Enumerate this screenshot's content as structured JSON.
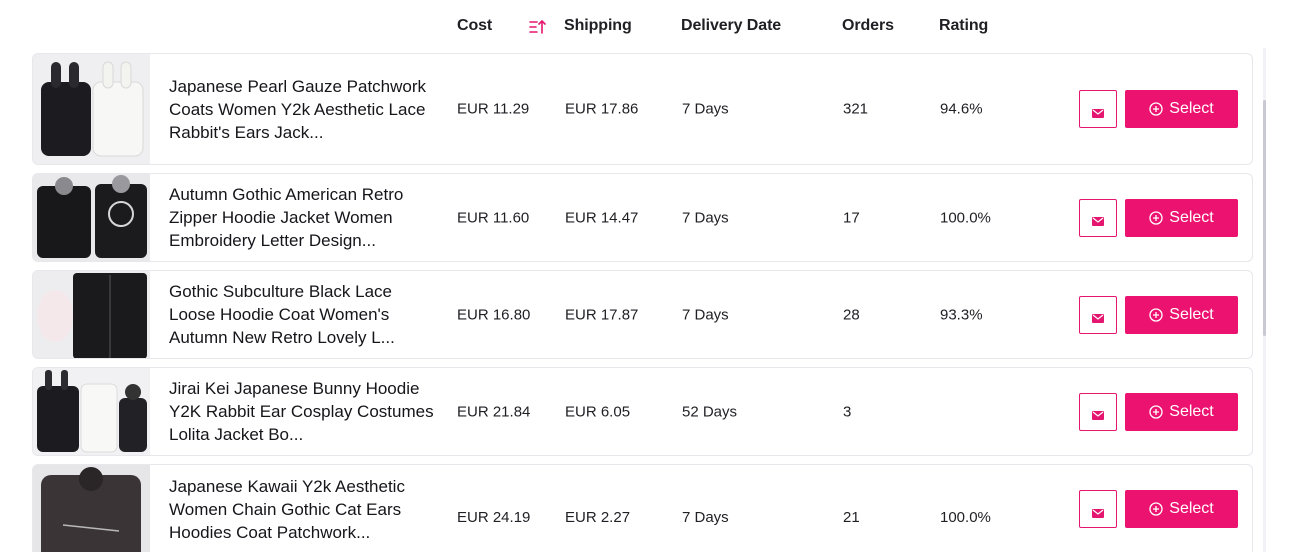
{
  "header": {
    "cost": "Cost",
    "shipping": "Shipping",
    "delivery_date": "Delivery Date",
    "orders": "Orders",
    "rating": "Rating",
    "sort_icon": "sort-ascending-icon"
  },
  "accent_color": "#ec1370",
  "select_label": "Select",
  "products": [
    {
      "title": "Japanese Pearl Gauze Patchwork Coats Women Y2k Aesthetic Lace Rabbit's Ears Jack...",
      "cost": "EUR 11.29",
      "shipping": "EUR 17.86",
      "delivery": "7 Days",
      "orders": "321",
      "rating": "94.6%"
    },
    {
      "title": "Autumn Gothic American Retro Zipper Hoodie Jacket Women Embroidery Letter Design...",
      "cost": "EUR 11.60",
      "shipping": "EUR 14.47",
      "delivery": "7 Days",
      "orders": "17",
      "rating": "100.0%"
    },
    {
      "title": "Gothic Subculture Black Lace Loose Hoodie Coat Women's Autumn New Retro Lovely L...",
      "cost": "EUR 16.80",
      "shipping": "EUR 17.87",
      "delivery": "7 Days",
      "orders": "28",
      "rating": "93.3%"
    },
    {
      "title": "Jirai Kei Japanese Bunny Hoodie Y2K Rabbit Ear Cosplay Costumes Lolita Jacket Bo...",
      "cost": "EUR 21.84",
      "shipping": "EUR 6.05",
      "delivery": "52 Days",
      "orders": "3",
      "rating": ""
    },
    {
      "title": "Japanese Kawaii Y2k Aesthetic Women Chain Gothic Cat Ears Hoodies Coat Patchwork...",
      "cost": "EUR 24.19",
      "shipping": "EUR 2.27",
      "delivery": "7 Days",
      "orders": "21",
      "rating": "100.0%"
    }
  ]
}
